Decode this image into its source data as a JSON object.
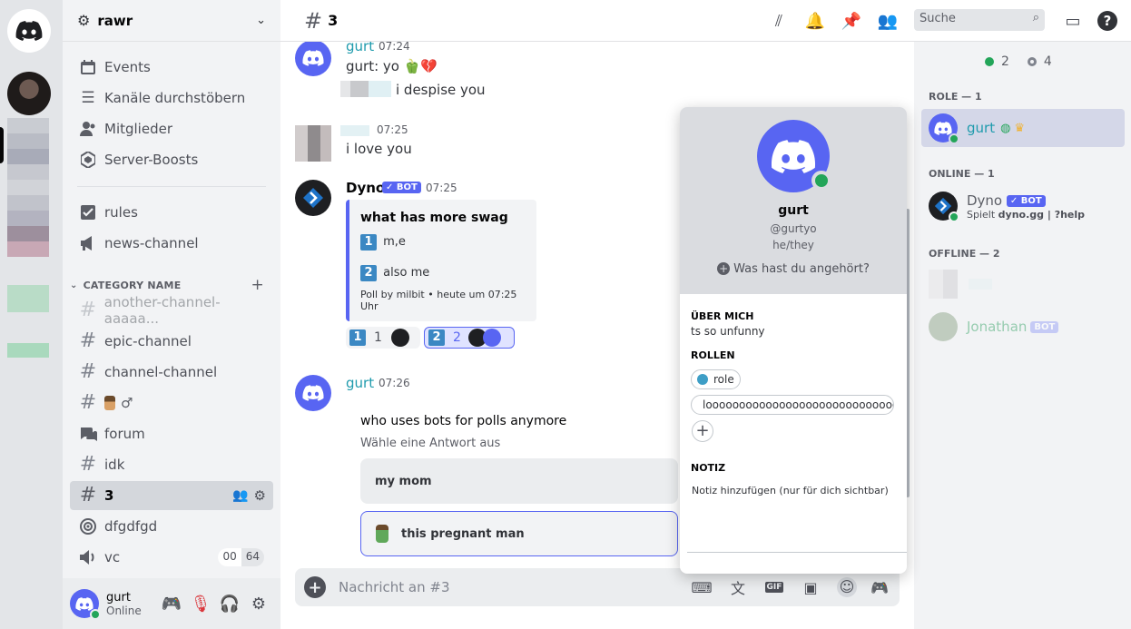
{
  "server": {
    "name": "rawr"
  },
  "sidebar": {
    "top_items": [
      {
        "label": "Events"
      },
      {
        "label": "Kanäle durchstöbern"
      },
      {
        "label": "Mitglieder"
      },
      {
        "label": "Server-Boosts"
      }
    ],
    "info_channels": [
      {
        "label": "rules"
      },
      {
        "label": "news-channel"
      }
    ],
    "category": {
      "label": "CATEGORY NAME",
      "add_glyph": "+"
    },
    "channels": [
      {
        "label": "another-channel-aaaaa..."
      },
      {
        "label": "epic-channel"
      },
      {
        "label": "channel-channel"
      },
      {
        "label": "♂"
      },
      {
        "label": "forum"
      },
      {
        "label": "idk"
      },
      {
        "label": "3"
      },
      {
        "label": "dfgdfgd"
      },
      {
        "label": "vc"
      }
    ],
    "vc_counts": [
      "00",
      "64"
    ]
  },
  "user_panel": {
    "name": "gurt",
    "status": "Online"
  },
  "header": {
    "channel_name": "3",
    "search_placeholder": "Suche"
  },
  "messages": [
    {
      "author": "gurt",
      "time": "07:24",
      "lines": [
        "gurt: yo 🫑💔",
        "i despise you"
      ]
    },
    {
      "author": "",
      "time": "07:25",
      "lines": [
        "i love you"
      ]
    },
    {
      "author": "Dyno",
      "bot_tag": "✓ BOT",
      "time": "07:25"
    },
    {
      "author": "gurt",
      "time": "07:26"
    }
  ],
  "embed": {
    "title": "what has more swag",
    "options": [
      {
        "num": "1",
        "label": "m,e"
      },
      {
        "num": "2",
        "label": "also me"
      }
    ],
    "footer": "Poll by milbit • heute um 07:25 Uhr"
  },
  "reactions": [
    {
      "num": "1",
      "count": "1"
    },
    {
      "num": "2",
      "count": "2"
    }
  ],
  "poll": {
    "question": "who uses bots for polls anymore",
    "hint": "Wähle eine Antwort aus",
    "options": [
      {
        "label": "my mom"
      },
      {
        "label": "this pregnant man"
      }
    ]
  },
  "composer": {
    "placeholder": "Nachricht an #3"
  },
  "members": {
    "online_count": "2",
    "offline_count": "4",
    "role_header": "ROLE — 1",
    "online_header": "ONLINE — 1",
    "offline_header": "OFFLINE — 2",
    "role_members": [
      {
        "name": "gurt"
      }
    ],
    "online_members": [
      {
        "name": "Dyno",
        "bot_tag": "✓ BOT",
        "activity_prefix": "Spielt ",
        "activity": "dyno.gg | ?help"
      }
    ],
    "offline_members": [
      {
        "name": ""
      },
      {
        "name": "Jonathan",
        "bot_tag": "BOT"
      }
    ]
  },
  "profile": {
    "display_name": "gurt",
    "username": "@gurtyo",
    "pronouns": "he/they",
    "listening_prompt": "Was hast du angehört?",
    "about_label": "ÜBER MICH",
    "about_text": "ts so unfunny",
    "roles_label": "ROLLEN",
    "roles": [
      {
        "name": "role",
        "color": "#3e9ec6"
      },
      {
        "name": "looooooooooooooooooooooooooooo...",
        "color": "#b5bac1"
      }
    ],
    "note_label": "NOTIZ",
    "note_placeholder": "Notiz hinzufügen (nur für dich sichtbar)"
  },
  "colors": {
    "blurple": "#5865f2",
    "online": "#23a559",
    "link_teal": "#1f9bad"
  }
}
